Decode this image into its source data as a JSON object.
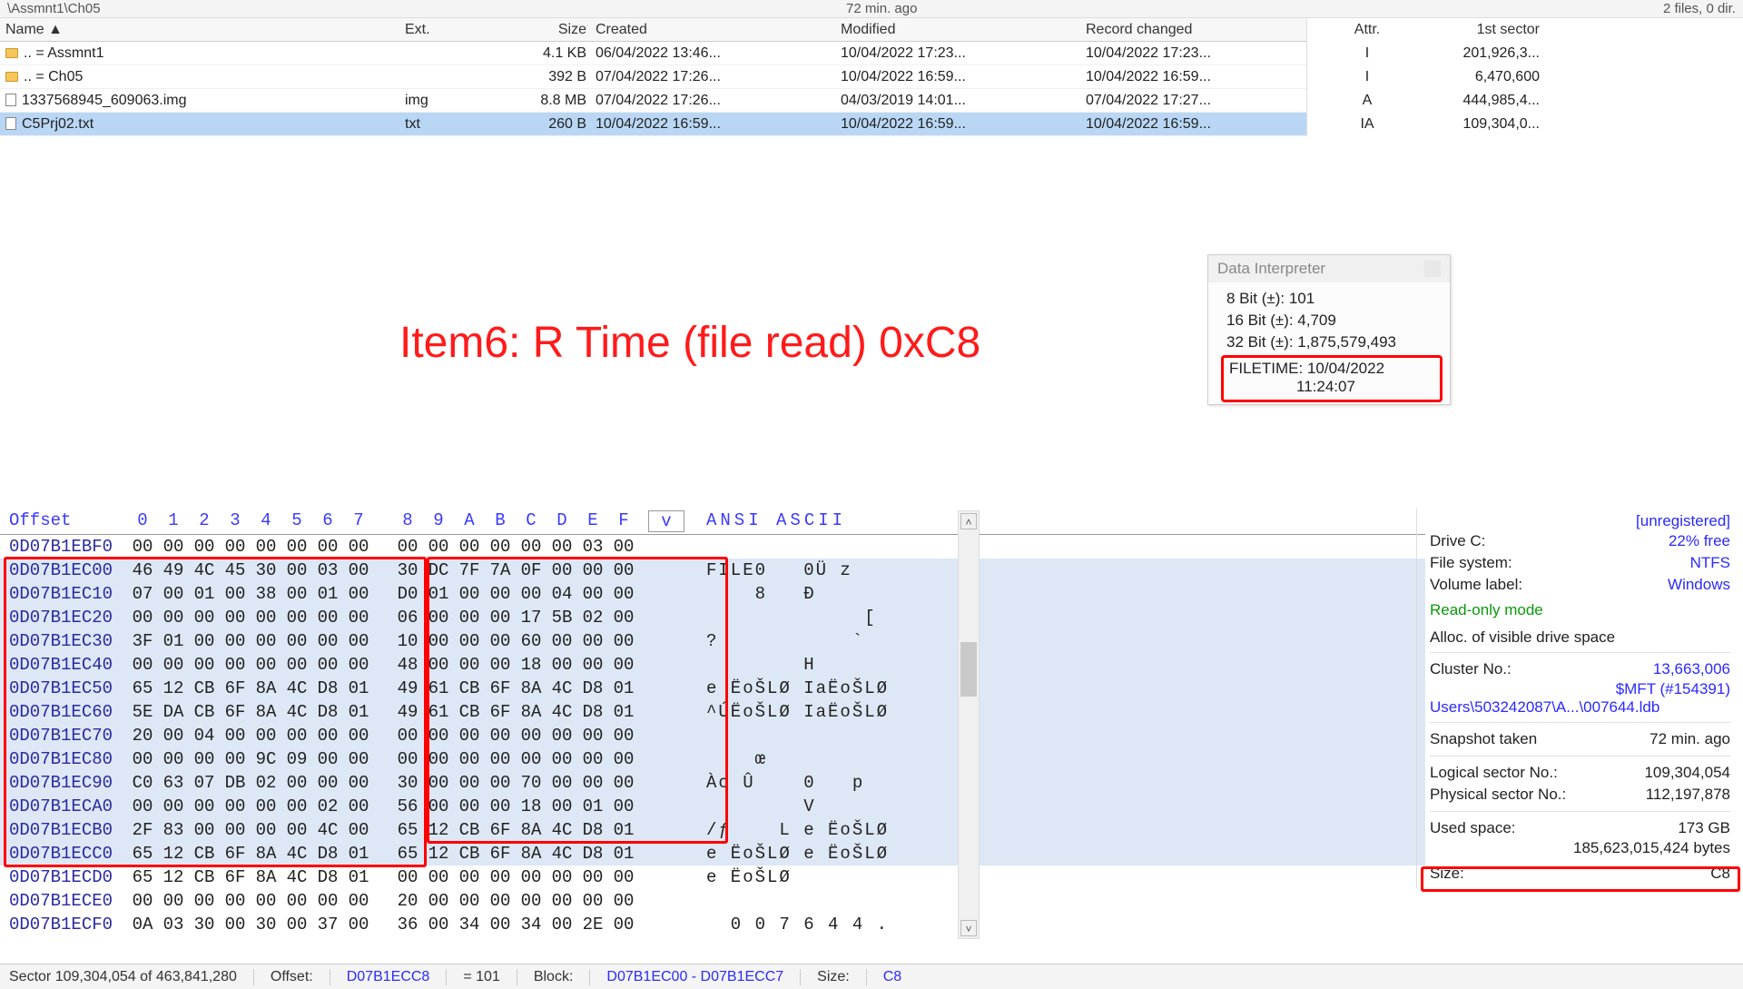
{
  "topbar": {
    "path": "\\Assmnt1\\Ch05",
    "center": "72 min. ago",
    "right": "2 files, 0 dir."
  },
  "fileList": {
    "columns": [
      "Name ▲",
      "Ext.",
      "Size",
      "Created",
      "Modified",
      "Record changed",
      "Attr.",
      "1st sector"
    ],
    "rows": [
      {
        "icon": "folder",
        "name": "..  =  Assmnt1",
        "ext": "",
        "size": "4.1 KB",
        "created": "06/04/2022   13:46...",
        "modified": "10/04/2022   17:23...",
        "rchanged": "10/04/2022   17:23...",
        "attr": "I",
        "sector": "201,926,3...",
        "selected": false
      },
      {
        "icon": "folder",
        "name": "..  =  Ch05",
        "ext": "",
        "size": "392 B",
        "created": "07/04/2022   17:26...",
        "modified": "10/04/2022   16:59...",
        "rchanged": "10/04/2022   16:59...",
        "attr": "I",
        "sector": "6,470,600",
        "selected": false
      },
      {
        "icon": "file",
        "name": "1337568945_609063.img",
        "ext": "img",
        "size": "8.8 MB",
        "created": "07/04/2022   17:26...",
        "modified": "04/03/2019   14:01...",
        "rchanged": "07/04/2022   17:27...",
        "attr": "A",
        "sector": "444,985,4...",
        "selected": false
      },
      {
        "icon": "file",
        "name": "C5Prj02.txt",
        "ext": "txt",
        "size": "260 B",
        "created": "10/04/2022   16:59...",
        "modified": "10/04/2022   16:59...",
        "rchanged": "10/04/2022   16:59...",
        "attr": "IA",
        "sector": "109,304,0...",
        "selected": true
      }
    ]
  },
  "annotation": "Item6: R Time (file read) 0xC8",
  "dataInterpreter": {
    "title": "Data Interpreter",
    "rows": [
      "8 Bit (±): 101",
      "16 Bit (±): 4,709",
      "32 Bit (±): 1,875,579,493"
    ],
    "filetime": {
      "line1": "FILETIME: 10/04/2022",
      "line2": "11:24:07"
    }
  },
  "hex": {
    "offsetLabel": "Offset",
    "headercols": [
      "0",
      "1",
      "2",
      "3",
      "4",
      "5",
      "6",
      "7",
      "8",
      "9",
      "A",
      "B",
      "C",
      "D",
      "E",
      "F"
    ],
    "vLabel": "v",
    "asciiLabel": "ANSI ASCII",
    "rows": [
      {
        "off": "0D07B1EBF0",
        "b": [
          "00",
          "00",
          "00",
          "00",
          "00",
          "00",
          "00",
          "00",
          "00",
          "00",
          "00",
          "00",
          "00",
          "00",
          "03",
          "00"
        ],
        "ascii": "              ",
        "hl": false
      },
      {
        "off": "0D07B1EC00",
        "b": [
          "46",
          "49",
          "4C",
          "45",
          "30",
          "00",
          "03",
          "00",
          "30",
          "DC",
          "7F",
          "7A",
          "0F",
          "00",
          "00",
          "00"
        ],
        "ascii": "FILE0   0Ü z    ",
        "hl": true
      },
      {
        "off": "0D07B1EC10",
        "b": [
          "07",
          "00",
          "01",
          "00",
          "38",
          "00",
          "01",
          "00",
          "D0",
          "01",
          "00",
          "00",
          "00",
          "04",
          "00",
          "00"
        ],
        "ascii": "    8   Ð       ",
        "hl": true
      },
      {
        "off": "0D07B1EC20",
        "b": [
          "00",
          "00",
          "00",
          "00",
          "00",
          "00",
          "00",
          "00",
          "06",
          "00",
          "00",
          "00",
          "17",
          "5B",
          "02",
          "00"
        ],
        "ascii": "             [  ",
        "hl": true
      },
      {
        "off": "0D07B1EC30",
        "b": [
          "3F",
          "01",
          "00",
          "00",
          "00",
          "00",
          "00",
          "00",
          "10",
          "00",
          "00",
          "00",
          "60",
          "00",
          "00",
          "00"
        ],
        "ascii": "?           `   ",
        "hl": true
      },
      {
        "off": "0D07B1EC40",
        "b": [
          "00",
          "00",
          "00",
          "00",
          "00",
          "00",
          "00",
          "00",
          "48",
          "00",
          "00",
          "00",
          "18",
          "00",
          "00",
          "00"
        ],
        "ascii": "        H       ",
        "hl": true
      },
      {
        "off": "0D07B1EC50",
        "b": [
          "65",
          "12",
          "CB",
          "6F",
          "8A",
          "4C",
          "D8",
          "01",
          "49",
          "61",
          "CB",
          "6F",
          "8A",
          "4C",
          "D8",
          "01"
        ],
        "ascii": "e ËoŠLØ IaËoŠLØ ",
        "hl": true
      },
      {
        "off": "0D07B1EC60",
        "b": [
          "5E",
          "DA",
          "CB",
          "6F",
          "8A",
          "4C",
          "D8",
          "01",
          "49",
          "61",
          "CB",
          "6F",
          "8A",
          "4C",
          "D8",
          "01"
        ],
        "ascii": "^ÚËoŠLØ IaËoŠLØ ",
        "hl": true
      },
      {
        "off": "0D07B1EC70",
        "b": [
          "20",
          "00",
          "04",
          "00",
          "00",
          "00",
          "00",
          "00",
          "00",
          "00",
          "00",
          "00",
          "00",
          "00",
          "00",
          "00"
        ],
        "ascii": "                ",
        "hl": true
      },
      {
        "off": "0D07B1EC80",
        "b": [
          "00",
          "00",
          "00",
          "00",
          "9C",
          "09",
          "00",
          "00",
          "00",
          "00",
          "00",
          "00",
          "00",
          "00",
          "00",
          "00"
        ],
        "ascii": "    œ           ",
        "hl": true
      },
      {
        "off": "0D07B1EC90",
        "b": [
          "C0",
          "63",
          "07",
          "DB",
          "02",
          "00",
          "00",
          "00",
          "30",
          "00",
          "00",
          "00",
          "70",
          "00",
          "00",
          "00"
        ],
        "ascii": "Àc Û    0   p   ",
        "hl": true
      },
      {
        "off": "0D07B1ECA0",
        "b": [
          "00",
          "00",
          "00",
          "00",
          "00",
          "00",
          "02",
          "00",
          "56",
          "00",
          "00",
          "00",
          "18",
          "00",
          "01",
          "00"
        ],
        "ascii": "        V       ",
        "hl": true
      },
      {
        "off": "0D07B1ECB0",
        "b": [
          "2F",
          "83",
          "00",
          "00",
          "00",
          "00",
          "4C",
          "00",
          "65",
          "12",
          "CB",
          "6F",
          "8A",
          "4C",
          "D8",
          "01"
        ],
        "ascii": "/ƒ    L e ËoŠLØ ",
        "hl": true
      },
      {
        "off": "0D07B1ECC0",
        "b": [
          "65",
          "12",
          "CB",
          "6F",
          "8A",
          "4C",
          "D8",
          "01",
          "65",
          "12",
          "CB",
          "6F",
          "8A",
          "4C",
          "D8",
          "01"
        ],
        "ascii": "e ËoŠLØ e ËoŠLØ ",
        "hl": true
      },
      {
        "off": "0D07B1ECD0",
        "b": [
          "65",
          "12",
          "CB",
          "6F",
          "8A",
          "4C",
          "D8",
          "01",
          "00",
          "00",
          "00",
          "00",
          "00",
          "00",
          "00",
          "00"
        ],
        "ascii": "e ËoŠLØ         ",
        "hl": false
      },
      {
        "off": "0D07B1ECE0",
        "b": [
          "00",
          "00",
          "00",
          "00",
          "00",
          "00",
          "00",
          "00",
          "20",
          "00",
          "00",
          "00",
          "00",
          "00",
          "00",
          "00"
        ],
        "ascii": "                ",
        "hl": false
      },
      {
        "off": "0D07B1ECF0",
        "b": [
          "0A",
          "03",
          "30",
          "00",
          "30",
          "00",
          "37",
          "00",
          "36",
          "00",
          "34",
          "00",
          "34",
          "00",
          "2E",
          "00"
        ],
        "ascii": "  0 0 7 6 4 4 . ",
        "hl": false
      }
    ]
  },
  "rightPanel": {
    "unreg": "[unregistered]",
    "drive": {
      "k": "Drive C:",
      "v": "22% free"
    },
    "fs": {
      "k": "File system:",
      "v": "NTFS"
    },
    "vol": {
      "k": "Volume label:",
      "v": "Windows"
    },
    "ro": "Read-only mode",
    "allocHeader": "Alloc. of visible drive space",
    "cluster": {
      "k": "Cluster No.:",
      "v": "13,663,006"
    },
    "mft": "$MFT (#154391)",
    "path": "Users\\503242087\\A...\\007644.ldb",
    "snapshot": {
      "k": "Snapshot taken",
      "v": "72 min. ago"
    },
    "lsector": {
      "k": "Logical sector No.:",
      "v": "109,304,054"
    },
    "psector": {
      "k": "Physical sector No.:",
      "v": "112,197,878"
    },
    "used": {
      "k": "Used space:",
      "v": "173 GB"
    },
    "usedBytes": "185,623,015,424 bytes",
    "sizeLabel": "Size:",
    "sizeCut": "C8"
  },
  "status": {
    "sector": "Sector 109,304,054 of 463,841,280",
    "offsetLabel": "Offset:",
    "offset": "D07B1ECC8",
    "eqLabel": "= 101",
    "blockLabel": "Block:",
    "block": "D07B1EC00 - D07B1ECC7",
    "sizeLabel": "Size:",
    "size": "C8"
  }
}
